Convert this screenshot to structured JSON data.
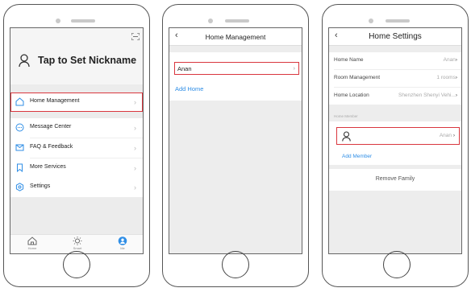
{
  "screen1": {
    "nickname": "Tap to Set Nickname",
    "menu": [
      {
        "label": "Home Management",
        "icon": "home-icon"
      },
      {
        "label": "Message Center",
        "icon": "message-icon"
      },
      {
        "label": "FAQ & Feedback",
        "icon": "faq-icon"
      },
      {
        "label": "More Services",
        "icon": "bookmark-icon"
      },
      {
        "label": "Settings",
        "icon": "gear-icon"
      }
    ],
    "tabs": [
      {
        "label": "Home",
        "icon": "home-tab-icon"
      },
      {
        "label": "Smart",
        "icon": "sun-icon"
      },
      {
        "label": "Me",
        "icon": "user-icon"
      }
    ]
  },
  "screen2": {
    "title": "Home Management",
    "home_item": "Anan",
    "add_home": "Add Home"
  },
  "screen3": {
    "title": "Home Settings",
    "rows": [
      {
        "label": "Home Name",
        "value": "Anan"
      },
      {
        "label": "Room Management",
        "value": "1 rooms"
      },
      {
        "label": "Home Location",
        "value": "Shenzhen Shenyi Vehi..."
      }
    ],
    "member_header": "Home Member",
    "member_value": "Anan",
    "add_member": "Add Member",
    "remove": "Remove Family"
  },
  "colors": {
    "highlight": "#d9363e",
    "link": "#2f8ee6",
    "active_tab": "#2f8ee6"
  }
}
